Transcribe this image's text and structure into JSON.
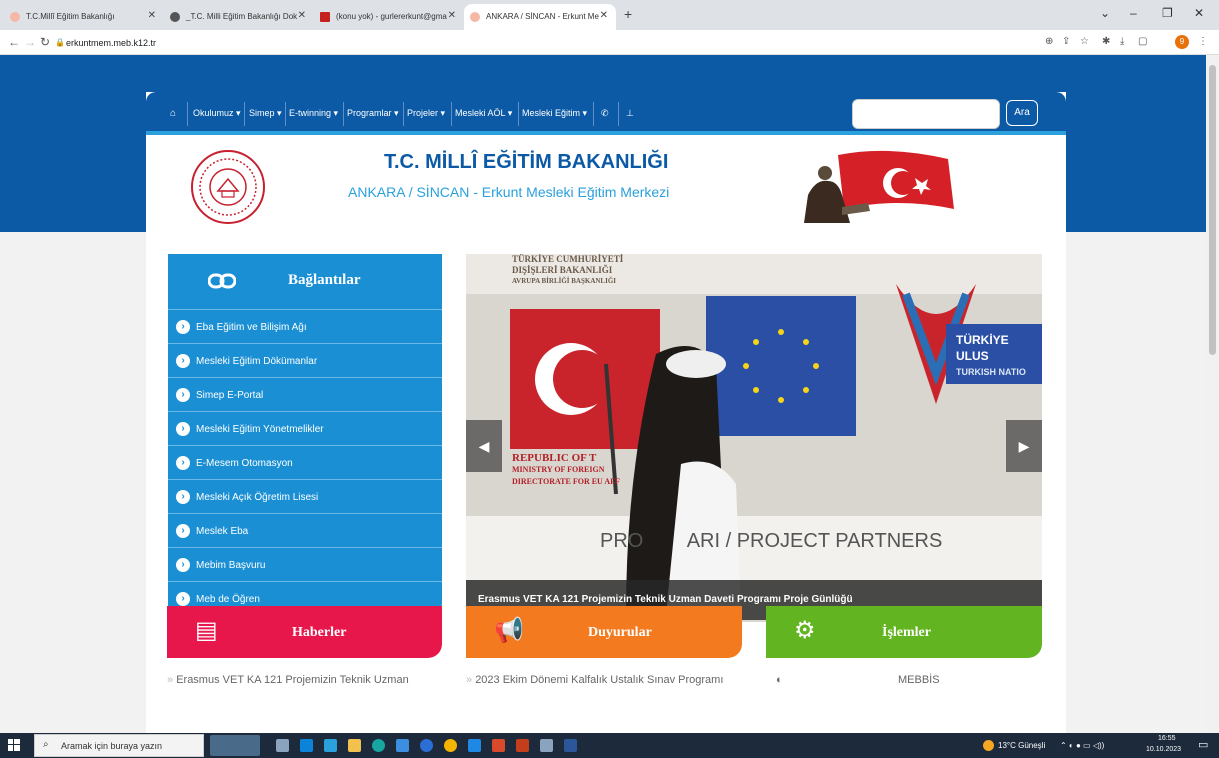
{
  "browser": {
    "tabs": [
      {
        "title": "T.C.Millî Eğitim Bakanlığı",
        "active": false,
        "favicon_color": "#f5b8a5"
      },
      {
        "title": "_T.C. Milli Eğitim Bakanlığı Dok",
        "active": false,
        "favicon_color": "#555555"
      },
      {
        "title": "(konu yok) - gurlererkunt@gma",
        "active": false,
        "favicon_color": "#c5221f"
      },
      {
        "title": "ANKARA / SİNCAN - Erkunt Me",
        "active": true,
        "favicon_color": "#f5b8a5"
      }
    ],
    "new_tab": "+",
    "url": "erkuntmem.meb.k12.tr",
    "profile_initial": "9"
  },
  "site": {
    "nav": [
      "Okulumuz",
      "Simep",
      "E-twinning",
      "Programlar",
      "Projeler",
      "Mesleki AÖL",
      "Mesleki Eğitim"
    ],
    "search_button": "Ara",
    "search_value": "",
    "header_title": "T.C. MİLLÎ EĞİTİM BAKANLIĞI",
    "header_subtitle": "ANKARA / SİNCAN - Erkunt Mesleki Eğitim Merkezi",
    "links_title": "Bağlantılar",
    "links": [
      "Eba Eğitim ve Bilişim Ağı",
      "Mesleki Eğitim Dökümanlar",
      "Simep E-Portal",
      "Mesleki Eğitim Yönetmelikler",
      "E-Mesem Otomasyon",
      "Mesleki Açık Öğretim Lisesi",
      "Meslek Eba",
      "Mebim Başvuru",
      "Meb de Öğren"
    ],
    "slider_caption": "Erasmus VET KA 121 Projemizin Teknik Uzman Daveti Programı Proje Günlüğü",
    "slider_texts": {
      "top_left": [
        "TÜRKİYE CUMHURİYETİ",
        "DIŞİŞLERİ BAKANLIĞI",
        "AVRUPA BİRLİĞİ BAŞKANLIĞI"
      ],
      "mid_left": [
        "REPUBLIC OF T",
        "MINISTRY OF FOREIGN",
        "DIRECTORATE FOR EU AFF"
      ],
      "right": [
        "TÜRKİYE ULUS",
        "TURKISH NATIO"
      ],
      "bottom": "PRO        ARI / PROJECT PARTNERS"
    },
    "cards": [
      {
        "title": "Haberler",
        "color": "#e8174b",
        "icon": "newspaper-icon"
      },
      {
        "title": "Duyurular",
        "color": "#f47a20",
        "icon": "megaphone-icon"
      },
      {
        "title": "İşlemler",
        "color": "#62b520",
        "icon": "gears-icon"
      }
    ],
    "card_items": [
      "Erasmus VET KA 121 Projemizin Teknik Uzman",
      "2023 Ekim Dönemi Kalfalık Ustalık Sınav Programı",
      "MEBBİS"
    ]
  },
  "taskbar": {
    "search_placeholder": "Aramak için buraya yazın",
    "weather": "13°C Güneşli",
    "time": "16:55",
    "date": "10.10.2023"
  }
}
